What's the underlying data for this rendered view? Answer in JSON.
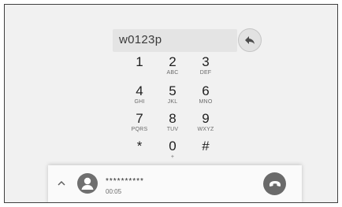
{
  "dialer": {
    "number": "w0123p",
    "backspace_icon": "back-arrow-icon"
  },
  "keypad": [
    {
      "digit": "1",
      "letters": ""
    },
    {
      "digit": "2",
      "letters": "ABC"
    },
    {
      "digit": "3",
      "letters": "DEF"
    },
    {
      "digit": "4",
      "letters": "GHI"
    },
    {
      "digit": "5",
      "letters": "JKL"
    },
    {
      "digit": "6",
      "letters": "MNO"
    },
    {
      "digit": "7",
      "letters": "PQRS"
    },
    {
      "digit": "8",
      "letters": "TUV"
    },
    {
      "digit": "9",
      "letters": "WXYZ"
    },
    {
      "digit": "*",
      "letters": ""
    },
    {
      "digit": "0",
      "letters": "+"
    },
    {
      "digit": "#",
      "letters": ""
    }
  ],
  "active_call": {
    "caller": "**********",
    "duration": "00:05",
    "expand_icon": "chevron-up-icon",
    "avatar_icon": "person-icon",
    "end_call_icon": "hang-up-icon"
  },
  "colors": {
    "background": "#f1f1f1",
    "frame": "#3f3f3f",
    "end_call": "#6a6a6a",
    "avatar": "#6f6f6f"
  }
}
